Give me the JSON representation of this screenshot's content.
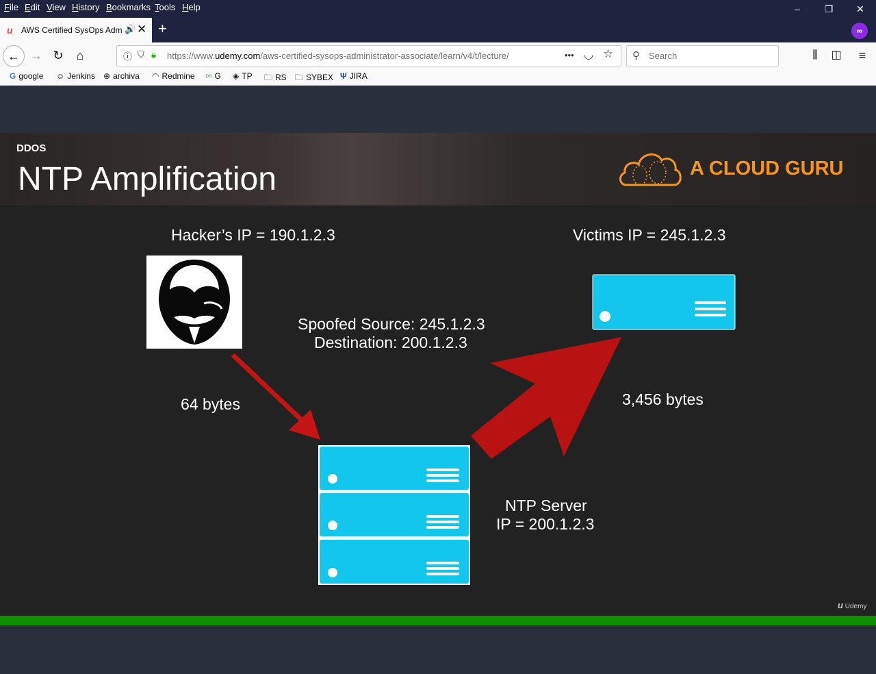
{
  "menu": [
    "File",
    "Edit",
    "View",
    "History",
    "Bookmarks",
    "Tools",
    "Help"
  ],
  "window_controls": [
    "–",
    "❐",
    "✕"
  ],
  "tab": {
    "title": "AWS Certified SysOps Administrator",
    "favicon": "udemy-icon",
    "audio_icon": "🔊",
    "close": "✕"
  },
  "new_tab": "+",
  "nav": {
    "back": "←",
    "forward": "→",
    "reload": "↻",
    "home": "⌂"
  },
  "address": {
    "url_prefix": "https://www.",
    "url_domain": "udemy.com",
    "url_rest": "/aws-certified-sysops-administrator-associate/learn/v4/t/lecture/",
    "more": "•••"
  },
  "search": {
    "placeholder": "Search"
  },
  "bookmarks": [
    {
      "label": "google",
      "icon": "G"
    },
    {
      "label": "Jenkins",
      "icon": "☺"
    },
    {
      "label": "archiva",
      "icon": "⊕"
    },
    {
      "label": "Redmine",
      "icon": "◠"
    },
    {
      "label": "G",
      "icon": "ᴰᴳ"
    },
    {
      "label": "TP",
      "icon": "◈"
    },
    {
      "label": "RS",
      "icon": "🗀"
    },
    {
      "label": "SYBEX",
      "icon": "🗀"
    },
    {
      "label": "JIRA",
      "icon": "Ψ"
    }
  ],
  "slide": {
    "section": "DDOS",
    "title": "NTP Amplification",
    "brand": "A CLOUD GURU",
    "hacker_ip": "Hacker’s IP = 190.1.2.3",
    "victim_ip": "Victims IP = 245.1.2.3",
    "spoofed_line1": "Spoofed Source: 245.1.2.3",
    "spoofed_line2": "Destination: 200.1.2.3",
    "request_size": "64 bytes",
    "response_size": "3,456 bytes",
    "server_line1": "NTP Server",
    "server_line2": "IP = 200.1.2.3",
    "watermark": "Udemy"
  },
  "colors": {
    "server": "#12c6ec",
    "arrow": "#b81212",
    "brand": "#f7941d",
    "progress": "#108f00"
  }
}
